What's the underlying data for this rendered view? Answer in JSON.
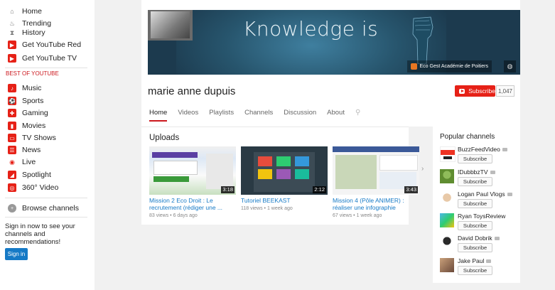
{
  "sidebar": {
    "top_items": [
      {
        "label": "Home",
        "icon": "home-icon"
      },
      {
        "label": "Trending",
        "icon": "flame-icon"
      },
      {
        "label": "History",
        "icon": "hourglass-icon"
      },
      {
        "label": "Get YouTube Red",
        "icon": "youtube-red-icon"
      },
      {
        "label": "Get YouTube TV",
        "icon": "youtube-tv-icon"
      }
    ],
    "section_title": "BEST OF YOUTUBE",
    "best_items": [
      {
        "label": "Music",
        "icon": "music-icon",
        "color": "#e62117"
      },
      {
        "label": "Sports",
        "icon": "sports-icon",
        "color": "#e62117"
      },
      {
        "label": "Gaming",
        "icon": "gaming-icon",
        "color": "#e62117"
      },
      {
        "label": "Movies",
        "icon": "movies-icon",
        "color": "#e62117"
      },
      {
        "label": "TV Shows",
        "icon": "tv-icon",
        "color": "#e62117"
      },
      {
        "label": "News",
        "icon": "news-icon",
        "color": "#e62117"
      },
      {
        "label": "Live",
        "icon": "live-icon",
        "color": "#e62117"
      },
      {
        "label": "Spotlight",
        "icon": "spotlight-icon",
        "color": "#e62117"
      },
      {
        "label": "360° Video",
        "icon": "360-video-icon",
        "color": "#e62117"
      }
    ],
    "browse_channels": "Browse channels",
    "signin_text": "Sign in now to see your channels and recommendations!",
    "signin_button": "Sign in"
  },
  "banner": {
    "title": "Knowledge is",
    "link_text": "Eco Gest Académie de Poitiers"
  },
  "channel": {
    "name": "marie anne dupuis",
    "subscribe_label": "Subscribe",
    "subscriber_count": "1,047",
    "tabs": [
      "Home",
      "Videos",
      "Playlists",
      "Channels",
      "Discussion",
      "About"
    ]
  },
  "uploads": {
    "title": "Uploads",
    "videos": [
      {
        "title": "Mission 2 Eco Droit : Le recrutement (rédiger une ...",
        "meta": "83 views • 6 days ago",
        "duration": "3:18"
      },
      {
        "title": "Tutoriel BEEKAST",
        "meta": "118 views • 1 week ago",
        "duration": "2:12"
      },
      {
        "title": "Mission 4 (Pôle ANIMER) : réaliser une infographie",
        "meta": "67 views • 1 week ago",
        "duration": "3:43"
      }
    ]
  },
  "popular": {
    "title": "Popular channels",
    "subscribe_label": "Subscribe",
    "channels": [
      {
        "name": "BuzzFeedVideo"
      },
      {
        "name": "IDubbbzTV"
      },
      {
        "name": "Logan Paul Vlogs"
      },
      {
        "name": "Ryan ToysReview"
      },
      {
        "name": "David Dobrik"
      },
      {
        "name": "Jake Paul"
      }
    ]
  }
}
